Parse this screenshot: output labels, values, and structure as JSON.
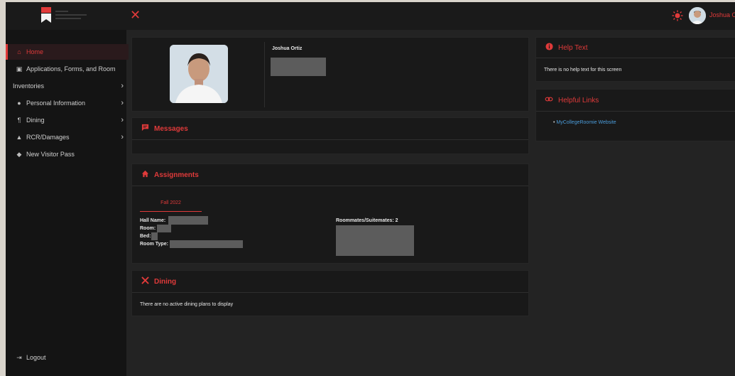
{
  "topbar": {
    "close_icon": "close-icon",
    "theme_icon": "sun-icon",
    "user_name": "Joshua Or"
  },
  "sidebar": {
    "items": [
      {
        "label": "Home",
        "icon": "home-icon",
        "active": true
      },
      {
        "label": "Applications, Forms, and Room",
        "icon": "form-icon"
      },
      {
        "label": "Inventories",
        "icon": "",
        "chevron": true
      },
      {
        "label": "Personal Information",
        "icon": "person-icon",
        "chevron": true
      },
      {
        "label": "Dining",
        "icon": "utensils-icon",
        "chevron": true
      },
      {
        "label": "RCR/Damages",
        "icon": "warning-icon",
        "chevron": true
      },
      {
        "label": "New Visitor Pass",
        "icon": "ticket-icon"
      }
    ],
    "logout": "Logout"
  },
  "profile": {
    "name": "Joshua Ortiz"
  },
  "messages": {
    "title": "Messages"
  },
  "assignments": {
    "title": "Assignments",
    "tab": "Fall 2022",
    "hall_label": "Hall Name:",
    "room_label": "Room:",
    "bed_label": "Bed:",
    "room_type_label": "Room Type:",
    "roommates_label": "Roommates/Suitemates: 2"
  },
  "dining": {
    "title": "Dining",
    "empty": "There are no active dining plans to display"
  },
  "help": {
    "title": "Help Text",
    "text": "There is no help text for this screen"
  },
  "links": {
    "title": "Helpful Links",
    "items": [
      "MyCollegeRoomie Website"
    ]
  },
  "colors": {
    "accent": "#e03a3a",
    "link": "#4a9bd9",
    "background": "#232323",
    "card": "#191919"
  }
}
